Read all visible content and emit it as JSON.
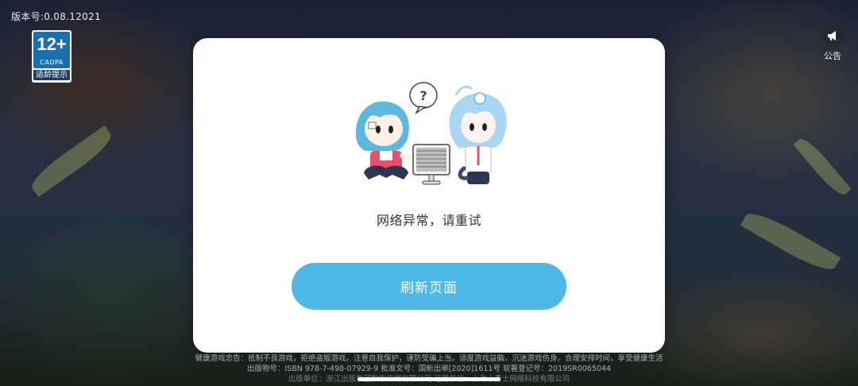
{
  "version": "版本号:0.08.12021",
  "age_rating": {
    "number": "12+",
    "org": "CADPA",
    "label": "适龄提示"
  },
  "notice": {
    "icon": "megaphone-icon",
    "label": "公告"
  },
  "dialog": {
    "message": "网络异常，请重试",
    "button_label": "刷新页面",
    "bubble_text": "?"
  },
  "footer": {
    "line1": "健康游戏忠告：抵制不良游戏，拒绝盗版游戏。注意自我保护，谨防受骗上当。适度游戏益脑，沉迷游戏伤身。合理安排时间，享受健康生活",
    "line2": "出版物号：ISBN 978-7-498-07929-9    批准文号：国新出审[2020]1611号    软著登记号：2019SR0065044",
    "line3": "出版单位：浙江出版集团数字传媒有限公司    运营单位：上海十勇士网络科技有限公司"
  },
  "colors": {
    "accent": "#4eb8e8",
    "dialog_bg": "#ffffff",
    "message_text": "#333333"
  }
}
